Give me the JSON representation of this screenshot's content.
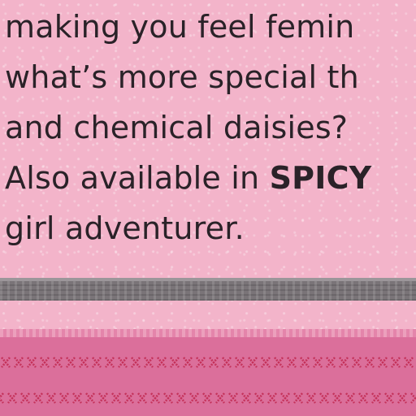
{
  "copy": {
    "line1": "making you feel femin",
    "line2": "what’s more special th",
    "line3": "and chemical daisies?",
    "line4_prefix": "Also available in ",
    "line4_bold": "SPICY",
    "line5": "girl adventurer."
  },
  "colors": {
    "paper": "#f3b4ca",
    "text": "#2a2228",
    "grey_bar": "#7a7478",
    "band": "#db6f9b",
    "stitch": "#c4325a"
  }
}
